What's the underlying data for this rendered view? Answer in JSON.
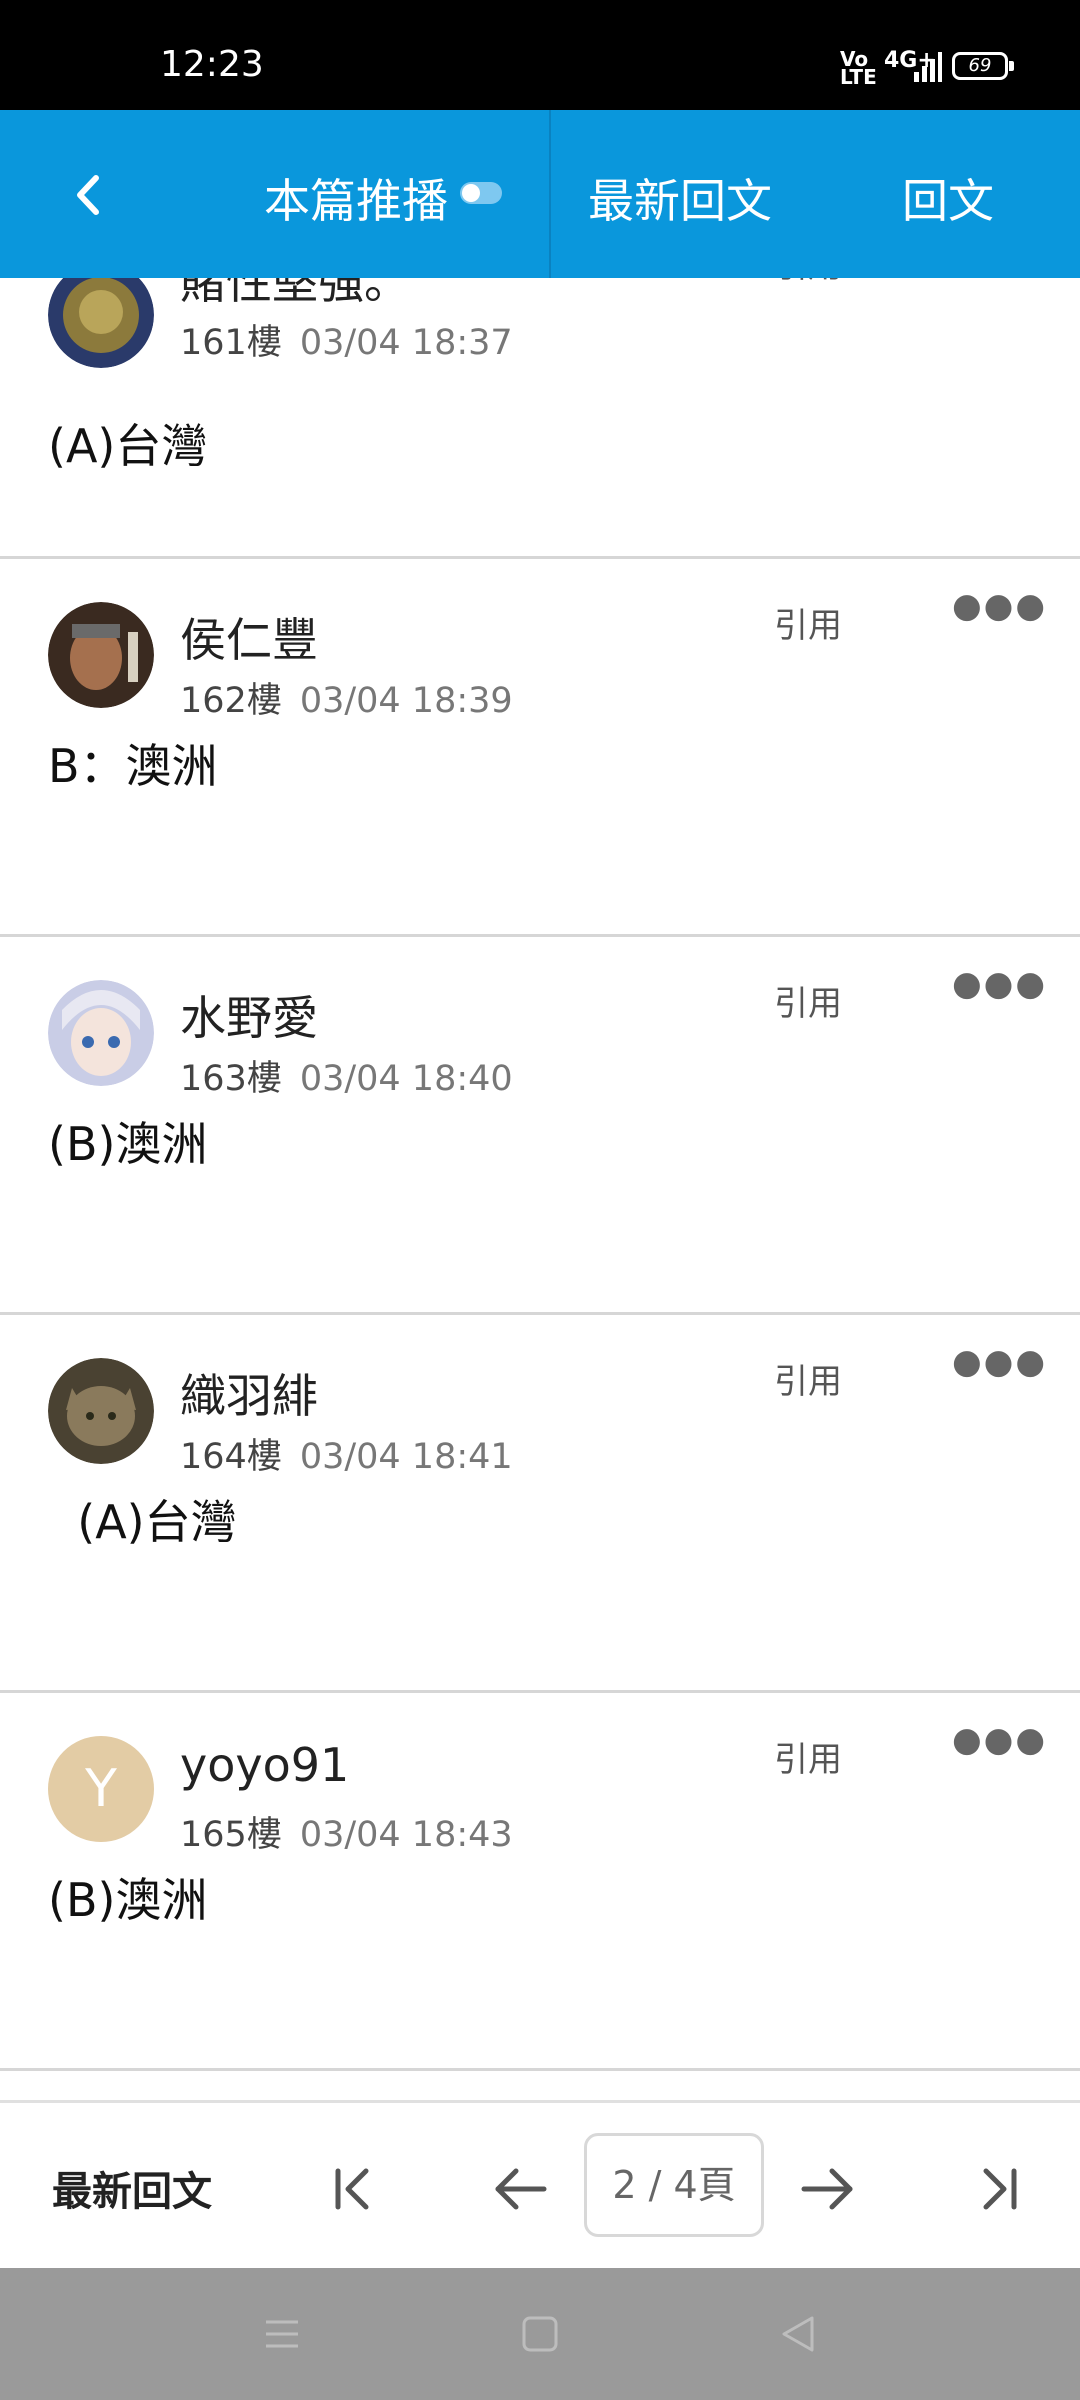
{
  "status_bar": {
    "time": "12:23",
    "network_volte": "Vo\nLTE",
    "network_type": "4G+",
    "battery": "69"
  },
  "app_bar": {
    "broadcast_tab": "本篇推播",
    "latest_replies_tab": "最新回文",
    "reply_button": "回文"
  },
  "posts": [
    {
      "author": "賭性堅強。",
      "floor": "161樓",
      "time": "03/04 18:37",
      "body": "(A)台灣",
      "quote_label": "引用",
      "avatar_color": "#7a6a30"
    },
    {
      "author": "侯仁豐",
      "floor": "162樓",
      "time": "03/04 18:39",
      "body": "B：澳洲",
      "quote_label": "引用",
      "avatar_color": "#5a3a2a"
    },
    {
      "author": "水野愛",
      "floor": "163樓",
      "time": "03/04 18:40",
      "body": "(B)澳洲",
      "quote_label": "引用",
      "avatar_color": "#c9cde6"
    },
    {
      "author": "織羽緋",
      "floor": "164樓",
      "time": "03/04 18:41",
      "body": "  (A)台灣",
      "quote_label": "引用",
      "avatar_color": "#6b5e45"
    },
    {
      "author": "yoyo91",
      "floor": "165樓",
      "time": "03/04 18:43",
      "body": "(B)澳洲",
      "quote_label": "引用",
      "avatar_letter": "Y",
      "avatar_color": "#e3cca5"
    }
  ],
  "pager": {
    "latest_label": "最新回文",
    "page_indicator": "2 / 4頁"
  },
  "colors": {
    "accent": "#0a97dc",
    "divider": "#d6d6d6"
  }
}
